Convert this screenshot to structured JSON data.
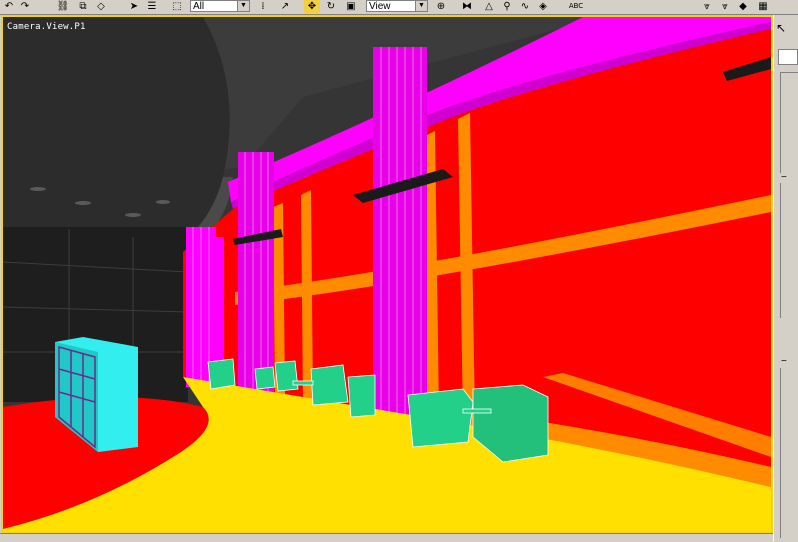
{
  "toolbar": {
    "select_filter": "All",
    "ref_coord": "View",
    "abc_label": "ABC"
  },
  "viewport": {
    "label": "Camera.View.P1"
  },
  "colors": {
    "border_active": "#f2d21b",
    "wall": "#ff0000",
    "floor": "#ffe000",
    "columns": "#ff00ff",
    "frames": "#ff8c00",
    "chairs": "#22d08a",
    "shelf": "#33eeee",
    "ceiling": "#2e2e2e"
  }
}
